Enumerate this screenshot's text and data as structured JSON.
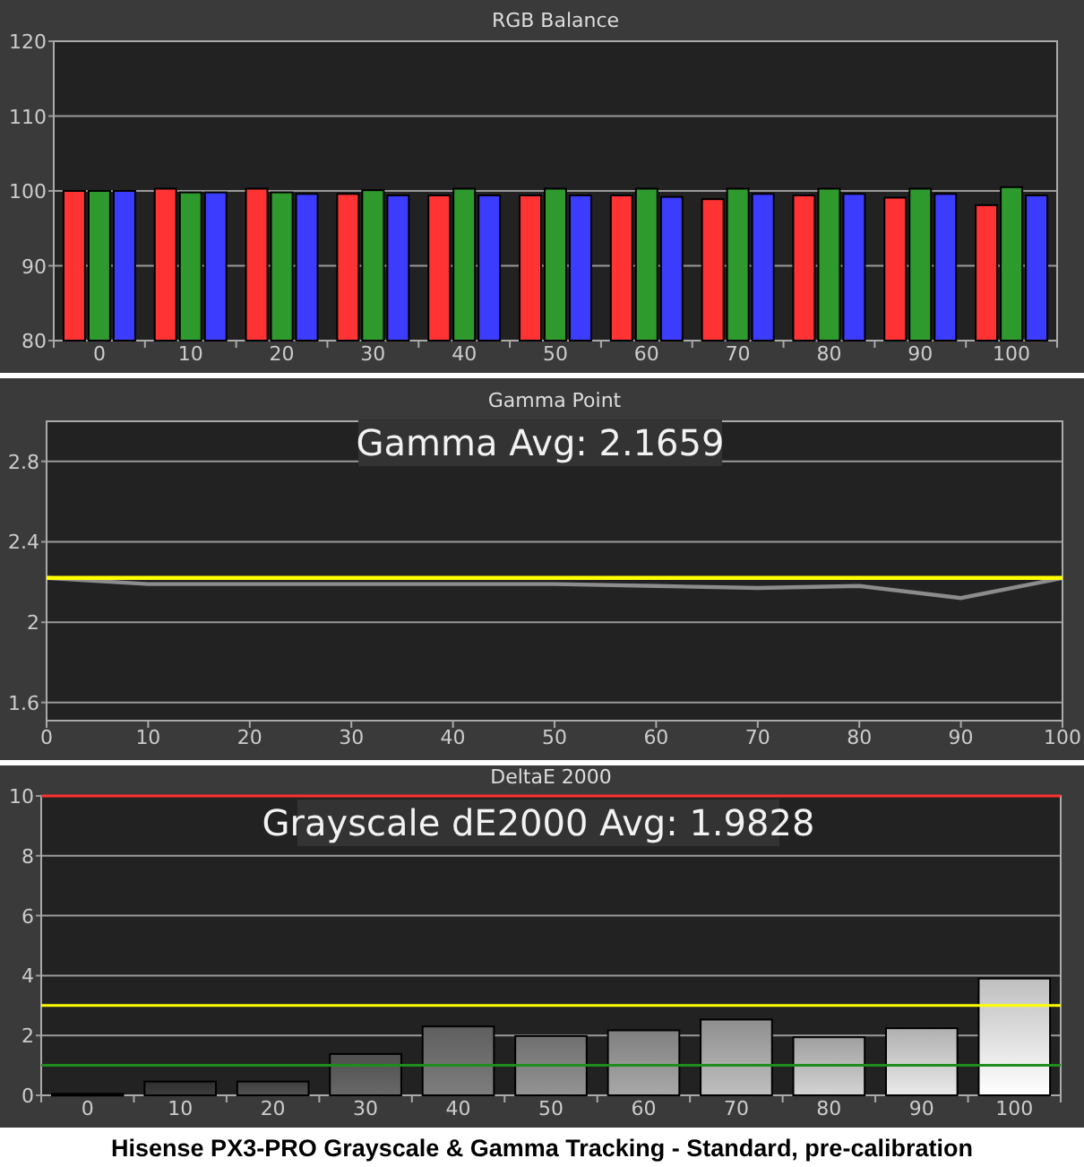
{
  "charts": [
    {
      "chart_data": {
        "type": "bar",
        "title": "RGB Balance",
        "grid": true,
        "categories": [
          "0",
          "10",
          "20",
          "30",
          "40",
          "50",
          "60",
          "70",
          "80",
          "90",
          "100"
        ],
        "ylim": [
          80,
          120
        ],
        "yticks": [
          80,
          90,
          100,
          110,
          120
        ],
        "series": [
          {
            "color": "#ff3333",
            "values": [
              100,
              100.3,
              100.3,
              99.6,
              99.4,
              99.4,
              99.4,
              98.9,
              99.4,
              99.1,
              98.1
            ]
          },
          {
            "color": "#2e9a2e",
            "values": [
              100,
              99.8,
              99.8,
              100.1,
              100.3,
              100.3,
              100.3,
              100.3,
              100.3,
              100.3,
              100.5
            ]
          },
          {
            "color": "#3c3cff",
            "values": [
              100,
              99.8,
              99.6,
              99.4,
              99.4,
              99.4,
              99.2,
              99.6,
              99.6,
              99.6,
              99.4
            ]
          }
        ]
      }
    },
    {
      "summary": "Gamma Avg: 2.1659",
      "chart_data": {
        "type": "line",
        "title": "Gamma Point",
        "grid": true,
        "x": [
          0,
          10,
          20,
          30,
          40,
          50,
          60,
          70,
          80,
          90,
          100
        ],
        "xlim": [
          0,
          100
        ],
        "ylim": [
          1.51,
          3.0
        ],
        "xticks": [
          0,
          10,
          20,
          30,
          40,
          50,
          60,
          70,
          80,
          90,
          100
        ],
        "yticks": [
          1.6,
          2,
          2.4,
          2.8
        ],
        "series": [
          {
            "color": "#8c8c8c",
            "values": [
              2.22,
              2.19,
              2.19,
              2.19,
              2.19,
              2.19,
              2.18,
              2.17,
              2.18,
              2.12,
              2.22
            ]
          },
          {
            "color": "#ffff00",
            "values": [
              2.22,
              2.22,
              2.22,
              2.22,
              2.22,
              2.22,
              2.22,
              2.22,
              2.22,
              2.22,
              2.22
            ]
          }
        ]
      }
    },
    {
      "summary": "Grayscale dE2000 Avg: 1.9828",
      "chart_data": {
        "type": "bar",
        "title": "DeltaE 2000",
        "grid": true,
        "categories": [
          "0",
          "10",
          "20",
          "30",
          "40",
          "50",
          "60",
          "70",
          "80",
          "90",
          "100"
        ],
        "ylim": [
          0,
          10
        ],
        "yticks": [
          0,
          2,
          4,
          6,
          8,
          10
        ],
        "values": [
          0.05,
          0.46,
          0.46,
          1.38,
          2.3,
          1.98,
          2.17,
          2.53,
          1.94,
          2.24,
          3.9
        ],
        "ref_lines": [
          {
            "axis": "y",
            "value": 10,
            "color": "#ff3030"
          },
          {
            "axis": "y",
            "value": 3,
            "color": "#ffff00"
          },
          {
            "axis": "y",
            "value": 1,
            "color": "#1e8c1e"
          }
        ]
      }
    }
  ],
  "caption": "Hisense PX3-PRO Grayscale & Gamma Tracking - Standard, pre-calibration"
}
